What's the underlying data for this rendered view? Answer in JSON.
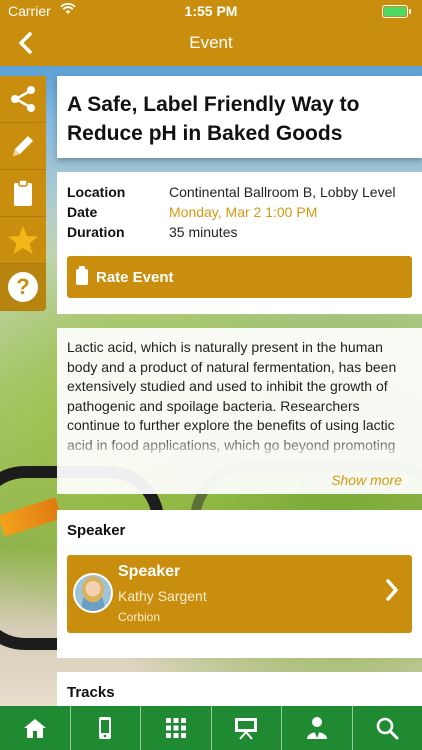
{
  "status_bar": {
    "carrier": "Carrier",
    "time": "1:55 PM"
  },
  "nav": {
    "back_icon": "chevron-left-icon",
    "title": "Event"
  },
  "action_rail": [
    {
      "icon": "share-icon"
    },
    {
      "icon": "pencil-icon"
    },
    {
      "icon": "clipboard-icon"
    },
    {
      "icon": "star-icon"
    },
    {
      "icon": "help-icon",
      "glyph": "?"
    }
  ],
  "event": {
    "title": "A Safe, Label Friendly Way to Reduce pH in Baked Goods",
    "location_label": "Location",
    "location_value": "Continental Ballroom B, Lobby Level",
    "date_label": "Date",
    "date_value": "Monday, Mar 2 1:00 PM",
    "duration_label": "Duration",
    "duration_value": "35 minutes",
    "rate_label": "Rate Event"
  },
  "description": {
    "text": "Lactic acid, which is naturally present in the human body and a product of natural fermentation, has been extensively studied and used to inhibit the growth of pathogenic and spoilage bacteria. Researchers continue to further explore the benefits of using lactic acid in food applications, which go beyond promoting food safety and preservation.",
    "show_more": "Show more"
  },
  "speaker_section": {
    "heading": "Speaker",
    "row_heading": "Speaker",
    "name": "Kathy Sargent",
    "organization": "Corbion"
  },
  "tracks_section": {
    "heading": "Tracks"
  },
  "colors": {
    "brand_gold": "#c98e0d",
    "date_gold": "#d49a14",
    "tabbar_green": "#1f8a32"
  },
  "tab_bar": [
    {
      "icon": "home-icon"
    },
    {
      "icon": "phone-icon"
    },
    {
      "icon": "grid-icon"
    },
    {
      "icon": "presentation-icon"
    },
    {
      "icon": "person-icon"
    },
    {
      "icon": "search-icon"
    }
  ]
}
